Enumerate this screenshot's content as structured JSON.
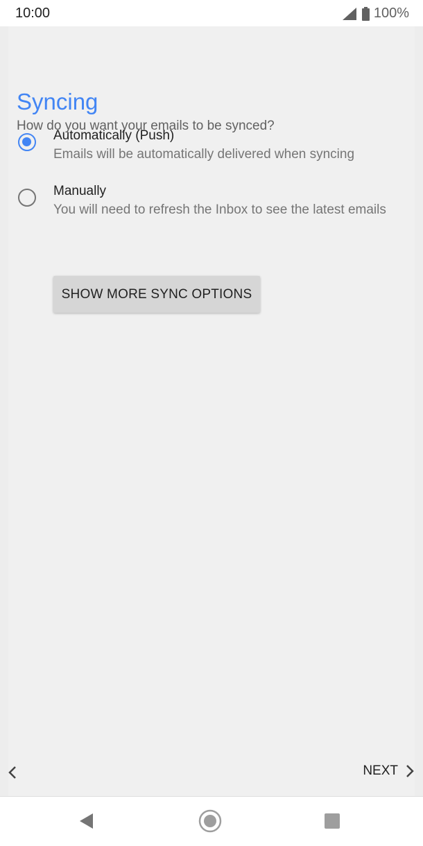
{
  "status_bar": {
    "time": "10:00",
    "battery": "100%",
    "icons": [
      "signal-icon",
      "battery-icon"
    ]
  },
  "page": {
    "title": "Syncing",
    "subtitle": "How do you want your emails to be synced?"
  },
  "options": [
    {
      "label": "Automatically (Push)",
      "description": "Emails will be automatically delivered when syncing",
      "selected": true
    },
    {
      "label": "Manually",
      "description": "You will need to refresh the Inbox to see the latest emails",
      "selected": false
    }
  ],
  "buttons": {
    "more_sync_options": "SHOW MORE SYNC OPTIONS",
    "next": "NEXT"
  },
  "nav_icons": [
    "back-chevron-icon",
    "next-chevron-icon",
    "nav-back-icon",
    "nav-home-icon",
    "nav-recents-icon"
  ],
  "colors": {
    "accent": "#4285f4",
    "background": "#f0f0f0",
    "button": "#d6d6d6"
  }
}
